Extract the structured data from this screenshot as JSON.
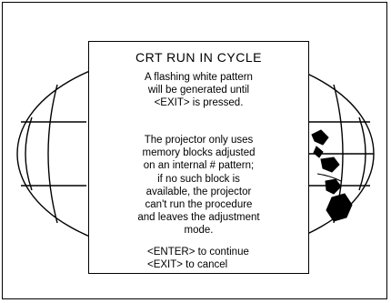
{
  "dialog": {
    "title": "CRT RUN IN CYCLE",
    "intro": "A flashing white pattern\nwill be generated until\n<EXIT> is pressed.",
    "body": "The projector only uses\nmemory blocks adjusted\non an internal # pattern;\nif no such block is\navailable, the projector\ncan't run the procedure\nand leaves the adjustment\nmode.",
    "enter_action": "<ENTER> to continue",
    "exit_action": "<EXIT> to cancel"
  },
  "background": {
    "icon": "world-map-globe-icon"
  }
}
